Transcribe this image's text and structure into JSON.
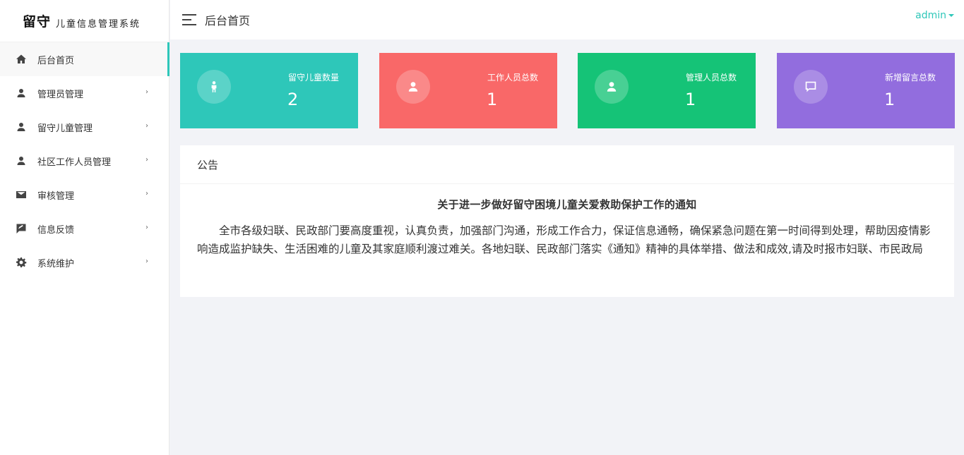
{
  "sidebar": {
    "logo_main": "留守",
    "logo_sub": "儿童信息管理系统",
    "items": [
      {
        "label": "后台首页",
        "icon": "home-icon",
        "active": true,
        "has_arrow": false
      },
      {
        "label": "管理员管理",
        "icon": "user-icon",
        "active": false,
        "has_arrow": true
      },
      {
        "label": "留守儿童管理",
        "icon": "user-icon",
        "active": false,
        "has_arrow": true
      },
      {
        "label": "社区工作人员管理",
        "icon": "user-icon",
        "active": false,
        "has_arrow": true
      },
      {
        "label": "审核管理",
        "icon": "mail-icon",
        "active": false,
        "has_arrow": true
      },
      {
        "label": "信息反馈",
        "icon": "feedback-icon",
        "active": false,
        "has_arrow": true
      },
      {
        "label": "系统维护",
        "icon": "gear-icon",
        "active": false,
        "has_arrow": true
      }
    ],
    "arrow_glyph": "›"
  },
  "header": {
    "title": "后台首页",
    "user": "admin"
  },
  "stats": [
    {
      "label": "留守儿童数量",
      "value": "2",
      "icon": "child-icon",
      "color": "#2ec7b9"
    },
    {
      "label": "工作人员总数",
      "value": "1",
      "icon": "user-icon",
      "color": "#f96868"
    },
    {
      "label": "管理人员总数",
      "value": "1",
      "icon": "user-icon",
      "color": "#15c377"
    },
    {
      "label": "新增留言总数",
      "value": "1",
      "icon": "message-icon",
      "color": "#926dde"
    }
  ],
  "notice": {
    "heading": "公告",
    "title": "关于进一步做好留守困境儿童关爱救助保护工作的通知",
    "body": "全市各级妇联、民政部门要高度重视，认真负责，加强部门沟通，形成工作合力，保证信息通畅，确保紧急问题在第一时间得到处理，帮助因疫情影响造成监护缺失、生活困难的儿童及其家庭顺利渡过难关。各地妇联、民政部门落实《通知》精神的具体举措、做法和成效,请及时报市妇联、市民政局"
  },
  "colors": {
    "accent": "#2ec7b9",
    "background": "#f2f3f7"
  }
}
